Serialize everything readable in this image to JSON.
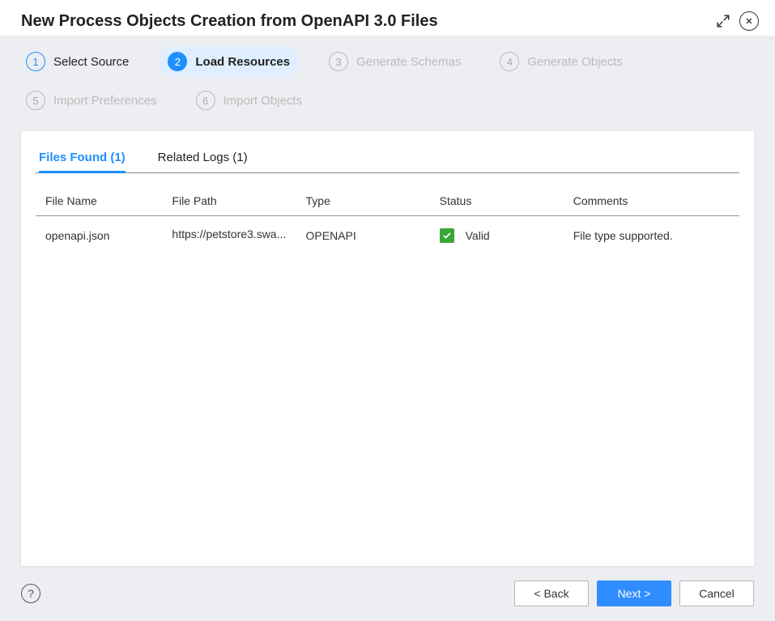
{
  "title": "New Process Objects Creation from OpenAPI 3.0 Files",
  "steps": [
    {
      "num": "1",
      "label": "Select Source",
      "state": "done"
    },
    {
      "num": "2",
      "label": "Load Resources",
      "state": "active"
    },
    {
      "num": "3",
      "label": "Generate Schemas",
      "state": "pending"
    },
    {
      "num": "4",
      "label": "Generate Objects",
      "state": "pending"
    },
    {
      "num": "5",
      "label": "Import Preferences",
      "state": "pending"
    },
    {
      "num": "6",
      "label": "Import Objects",
      "state": "pending"
    }
  ],
  "tabs": {
    "files": "Files Found (1)",
    "logs": "Related Logs (1)"
  },
  "columns": {
    "name": "File Name",
    "path": "File Path",
    "type": "Type",
    "status": "Status",
    "comments": "Comments"
  },
  "rows": [
    {
      "name": "openapi.json",
      "path": "https://petstore3.swa...",
      "type": "OPENAPI",
      "status": "Valid",
      "comments": "File type supported."
    }
  ],
  "footer": {
    "back": "< Back",
    "next": "Next >",
    "cancel": "Cancel"
  }
}
